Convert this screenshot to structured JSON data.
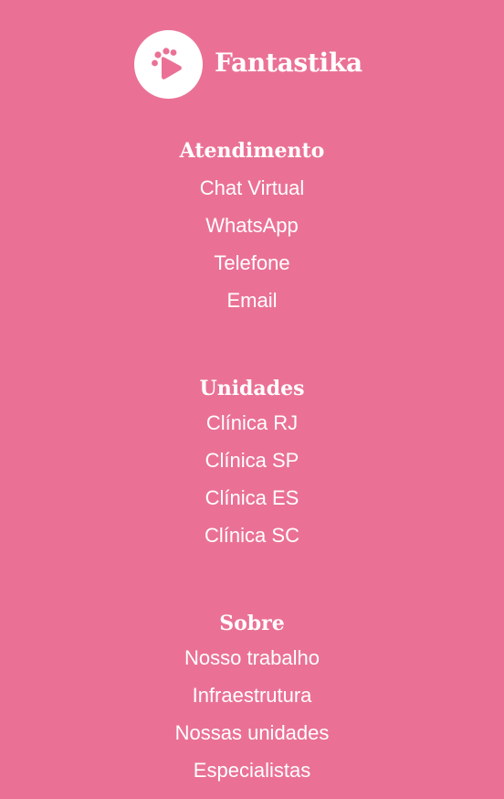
{
  "brand": {
    "name": "Fantastika",
    "logo_icon": "paw-play-icon",
    "logo_color": "#ea7195"
  },
  "colors": {
    "background": "#ea7195",
    "text": "#ffffff"
  },
  "sections": [
    {
      "title": "Atendimento",
      "links": [
        "Chat Virtual",
        "WhatsApp",
        "Telefone",
        "Email"
      ]
    },
    {
      "title": "Unidades",
      "links": [
        "Clínica RJ",
        "Clínica SP",
        "Clínica ES",
        "Clínica SC"
      ]
    },
    {
      "title": "Sobre",
      "links": [
        "Nosso trabalho",
        "Infraestrutura",
        "Nossas unidades",
        "Especialistas"
      ]
    }
  ]
}
